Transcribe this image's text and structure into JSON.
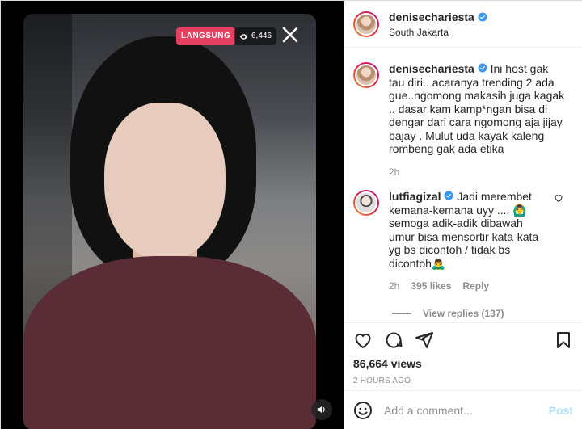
{
  "live": {
    "badge": "LANGSUNG",
    "viewers": "6,446"
  },
  "post": {
    "author": "denisechariesta",
    "location": "South Jakarta",
    "caption": "Ini host gak tau diri.. acaranya trending 2 ada gue..ngomong makasih juga kagak .. dasar kam kamp*ngan bisa di dengar dari cara ngomong aja jijay bajay . Mulut uda kayak kaleng rombeng gak ada etika",
    "caption_time": "2h",
    "views": "86,664 views",
    "posted": "2 HOURS AGO"
  },
  "comment": {
    "author": "lutfiagizal",
    "text": "Jadi merembet kemana-kemana uyy .... 🙆‍♂️ semoga adik-adik dibawah umur bisa mensortir kata-kata yg bs dicontoh / tidak bs dicontoh🙇‍♂️",
    "time": "2h",
    "likes": "395 likes",
    "reply": "Reply",
    "view_replies": "View replies (137)"
  },
  "composer": {
    "placeholder": "Add a comment...",
    "post_label": "Post"
  },
  "colors": {
    "accent_blue": "#0095f6",
    "verified": "#3897f0",
    "live_red": "#e4405f"
  }
}
